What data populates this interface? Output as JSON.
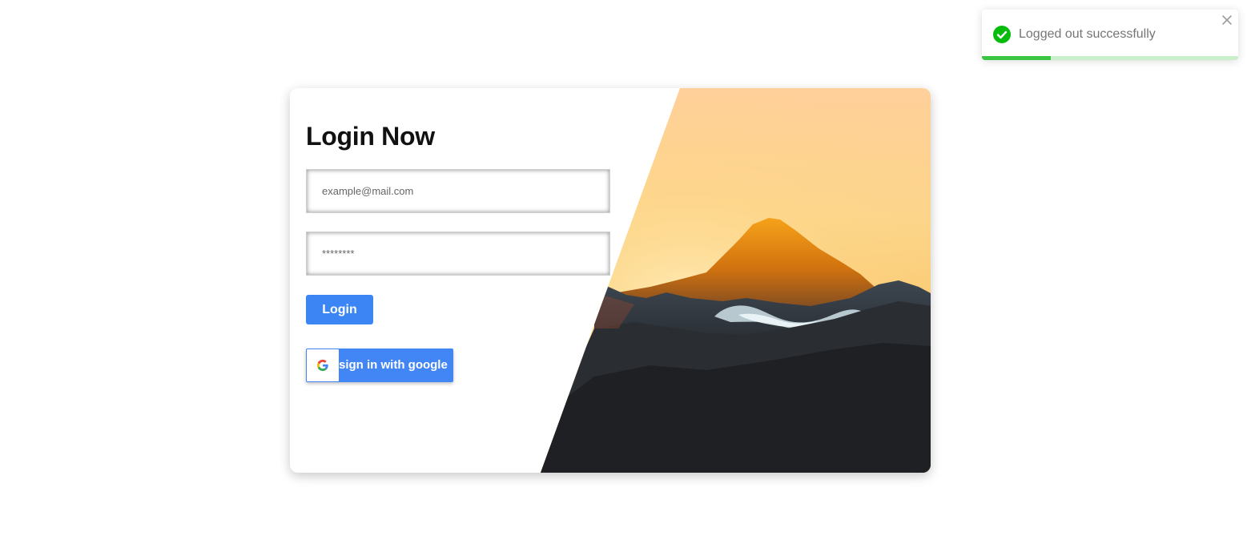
{
  "toast": {
    "message": "Logged out successfully",
    "type": "success",
    "progress": 0.27,
    "icons": {
      "status": "check-circle-icon",
      "close": "close-icon"
    },
    "colors": {
      "success": "#07bc0c",
      "progress": "#3cc443",
      "progress_track": "#c9efca"
    }
  },
  "login": {
    "title": "Login Now",
    "email_placeholder": "example@mail.com",
    "password_placeholder": "********",
    "login_label": "Login",
    "google_label": "sign in with google",
    "colors": {
      "primary": "#3b86f4",
      "google": "#4285f4"
    },
    "icons": {
      "google": "google-logo-icon"
    }
  },
  "hero": {
    "subject": "mountain sunset"
  }
}
